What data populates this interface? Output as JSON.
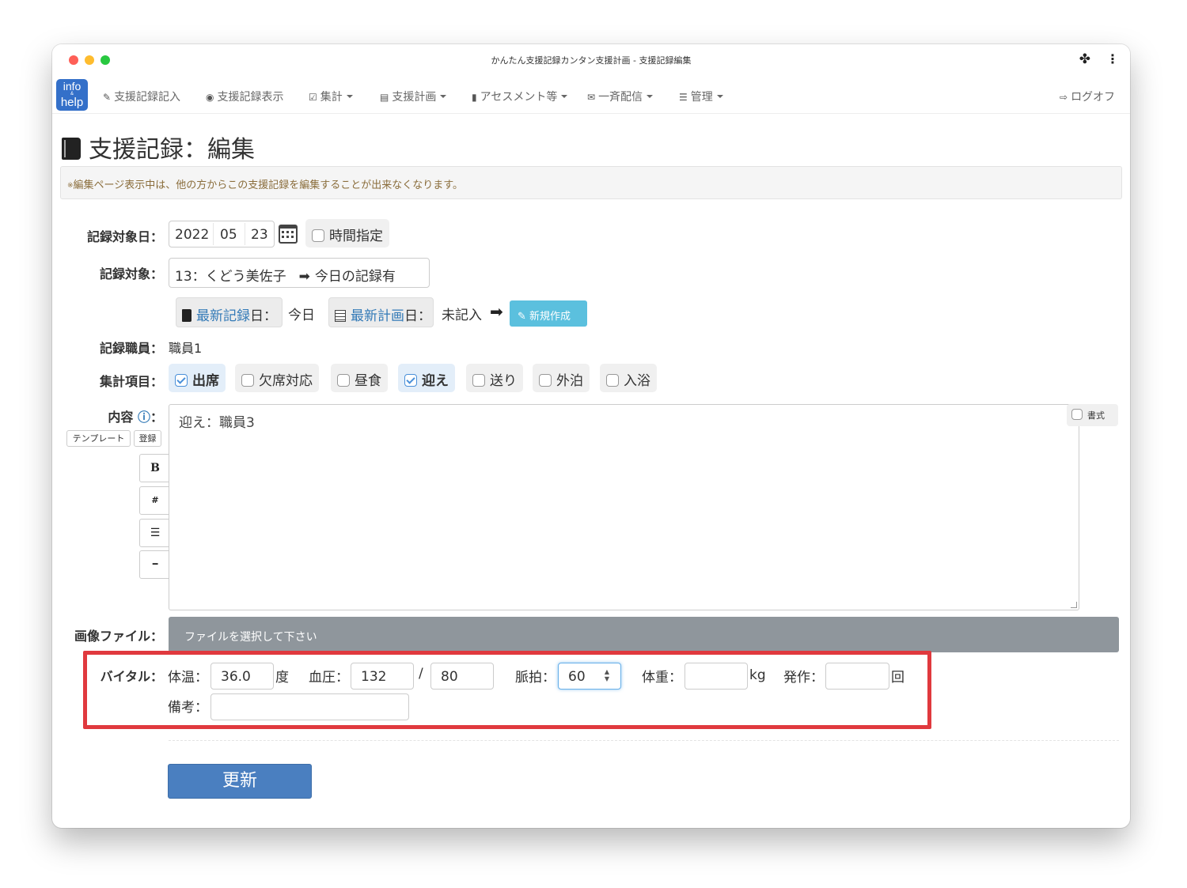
{
  "window": {
    "title": "かんたん支援記録カンタン支援計画 - 支援記録編集"
  },
  "logo": {
    "line1": "info",
    "line2": "&",
    "line3": "help"
  },
  "nav": {
    "items": [
      {
        "label": "支援記録記入"
      },
      {
        "label": "支援記録表示"
      },
      {
        "label": "集計"
      },
      {
        "label": "支援計画"
      },
      {
        "label": "アセスメント等"
      },
      {
        "label": "一斉配信"
      },
      {
        "label": "管理"
      }
    ],
    "logoff": "ログオフ"
  },
  "page": {
    "title": "支援記録：編集",
    "notice_mark": "※",
    "notice": "編集ページ表示中は、他の方からこの支援記録を編集することが出来なくなります。"
  },
  "form": {
    "date": {
      "label": "記録対象日：",
      "year": "2022",
      "month": "05",
      "day": "23",
      "time_label": "時間指定"
    },
    "subject": {
      "label": "記録対象：",
      "value": "13：くどう美佐子",
      "arrow": "➡",
      "status": "今日の記録有"
    },
    "latest": {
      "record_link": "最新記録",
      "record_suffix": "日：",
      "record_value": "今日",
      "plan_link": "最新計画",
      "plan_suffix": "日：",
      "plan_value": "未記入",
      "arrow": "➡",
      "new_button": "新規作成"
    },
    "staff": {
      "label": "記録職員：",
      "value": "職員1"
    },
    "items": {
      "label": "集計項目：",
      "options": [
        {
          "label": "出席",
          "checked": true
        },
        {
          "label": "欠席対応",
          "checked": false
        },
        {
          "label": "昼食",
          "checked": false
        },
        {
          "label": "迎え",
          "checked": true
        },
        {
          "label": "送り",
          "checked": false
        },
        {
          "label": "外泊",
          "checked": false
        },
        {
          "label": "入浴",
          "checked": false
        }
      ]
    },
    "content": {
      "label": "内容",
      "colon": "：",
      "template_button": "テンプレート",
      "register_button": "登録",
      "format_buttons": [
        "B",
        "#",
        "☰",
        "━"
      ],
      "text": "迎え：職員3",
      "format_label": "書式"
    },
    "file": {
      "label": "画像ファイル：",
      "placeholder": "ファイルを選択して下さい"
    },
    "vital": {
      "label": "バイタル：",
      "temp_label": "体温：",
      "temp_value": "36.0",
      "temp_unit": "度",
      "bp_label": "血圧：",
      "bp_high": "132",
      "bp_sep": "/",
      "bp_low": "80",
      "pulse_label": "脈拍：",
      "pulse_value": "60",
      "weight_label": "体重：",
      "weight_value": "",
      "weight_unit": "kg",
      "seizure_label": "発作：",
      "seizure_value": "",
      "seizure_unit": "回",
      "note_label": "備考：",
      "note_value": ""
    },
    "submit": "更新"
  },
  "colors": {
    "highlight": "#e0393e",
    "primary": "#4a7fc0",
    "info": "#5bc0de",
    "link": "#337ab7"
  }
}
